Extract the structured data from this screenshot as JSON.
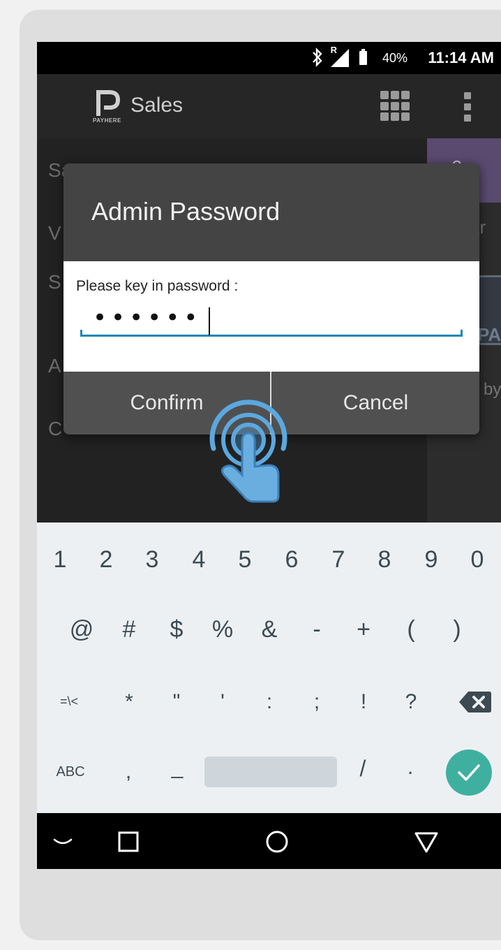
{
  "status_bar": {
    "roaming_label": "R",
    "battery_percent": "40%",
    "time": "11:14 AM"
  },
  "app_bar": {
    "logo_text": "PAYHERE",
    "title": "Sales"
  },
  "background": {
    "menu_items": [
      "Sa",
      "V",
      "S",
      "A",
      "C"
    ],
    "right_badge": ": 2",
    "right_text": "ar",
    "qr_text": "PA",
    "footer_text": "by"
  },
  "dialog": {
    "title": "Admin Password",
    "prompt": "Please key in password :",
    "password_value": "••••••",
    "confirm_label": "Confirm",
    "cancel_label": "Cancel"
  },
  "keyboard": {
    "row1": [
      "1",
      "2",
      "3",
      "4",
      "5",
      "6",
      "7",
      "8",
      "9",
      "0"
    ],
    "row2": [
      "@",
      "#",
      "$",
      "%",
      "&",
      "-",
      "+",
      "(",
      ")"
    ],
    "row3": [
      "=\\<",
      "*",
      "\"",
      "'",
      ":",
      ";",
      "!",
      "?"
    ],
    "row4": [
      "ABC",
      ",",
      "_",
      "/",
      "."
    ]
  },
  "colors": {
    "accent_underline": "#1c88b6",
    "enter_key": "#3fb0a0",
    "touch_indicator": "#5ba8e0"
  }
}
